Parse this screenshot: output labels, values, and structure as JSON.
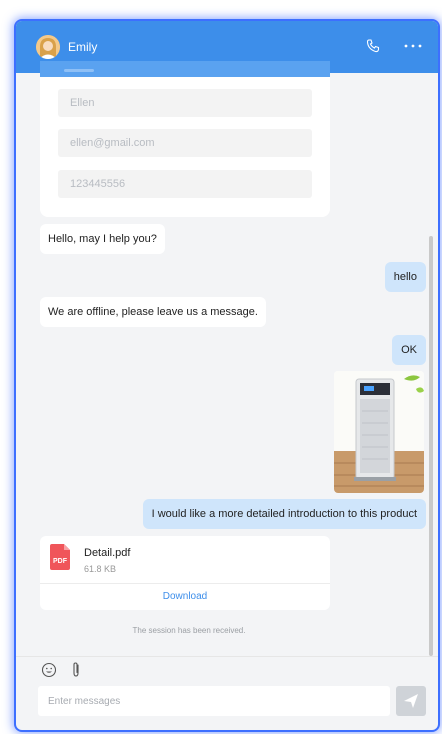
{
  "header": {
    "title": "Emily"
  },
  "form": {
    "name_value": "Ellen",
    "email_value": "ellen@gmail.com",
    "phone_value": "123445556"
  },
  "messages": [
    {
      "side": "left",
      "text": "Hello, may I help you?"
    },
    {
      "side": "right",
      "text": "hello"
    },
    {
      "side": "left",
      "text": "We are offline, please leave us a message."
    },
    {
      "side": "right",
      "text": "OK"
    },
    {
      "side": "right",
      "text": "I would like a more detailed introduction to this product"
    }
  ],
  "file": {
    "name": "Detail.pdf",
    "size": "61.8 KB",
    "download_label": "Download",
    "type_label": "PDF"
  },
  "notice": "The session has been received.",
  "composer": {
    "placeholder": "Enter messages"
  },
  "colors": {
    "header": "#3d8eea",
    "outgoing_bubble": "#cfe5fb",
    "pdf": "#f0555a",
    "send_disabled": "#cfd3d8"
  },
  "icons": [
    "avatar",
    "phone-icon",
    "more-icon",
    "pdf-icon",
    "emoji-icon",
    "attach-icon",
    "send-icon"
  ]
}
